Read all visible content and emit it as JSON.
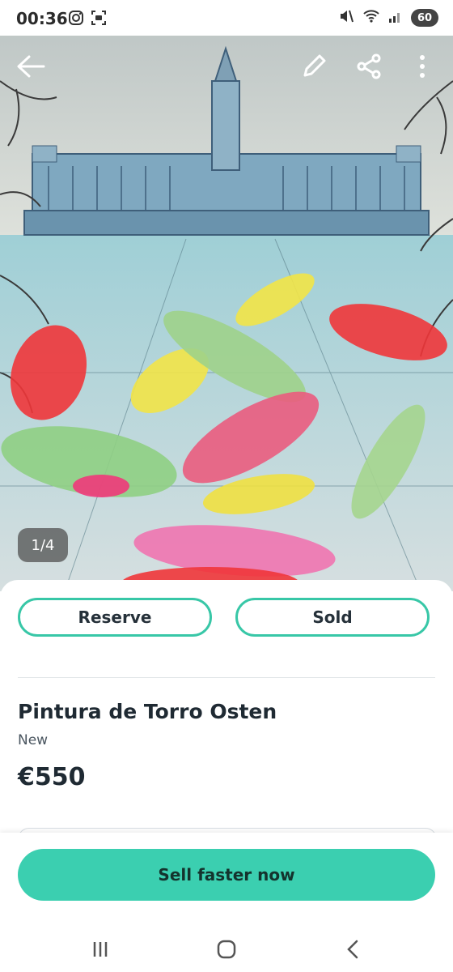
{
  "status_bar": {
    "time": "00:36",
    "battery": "60",
    "icons": [
      "instagram-icon",
      "screenshot-icon",
      "mute-icon",
      "wifi-icon",
      "signal-icon"
    ]
  },
  "hero": {
    "counter": "1/4",
    "icons": [
      "back-arrow-icon",
      "pencil-icon",
      "share-icon",
      "more-vertical-icon"
    ]
  },
  "actions": {
    "reserve_label": "Reserve",
    "sold_label": "Sold"
  },
  "listing": {
    "title": "Pintura de Torro Osten",
    "condition": "New",
    "price": "€550"
  },
  "cta": {
    "label": "Sell faster now"
  },
  "colors": {
    "accent": "#3bcfb0",
    "accent_border": "#38c7a7",
    "text": "#1f2a33"
  },
  "nav": {
    "icons": [
      "recents-icon",
      "home-icon",
      "back-icon"
    ]
  }
}
